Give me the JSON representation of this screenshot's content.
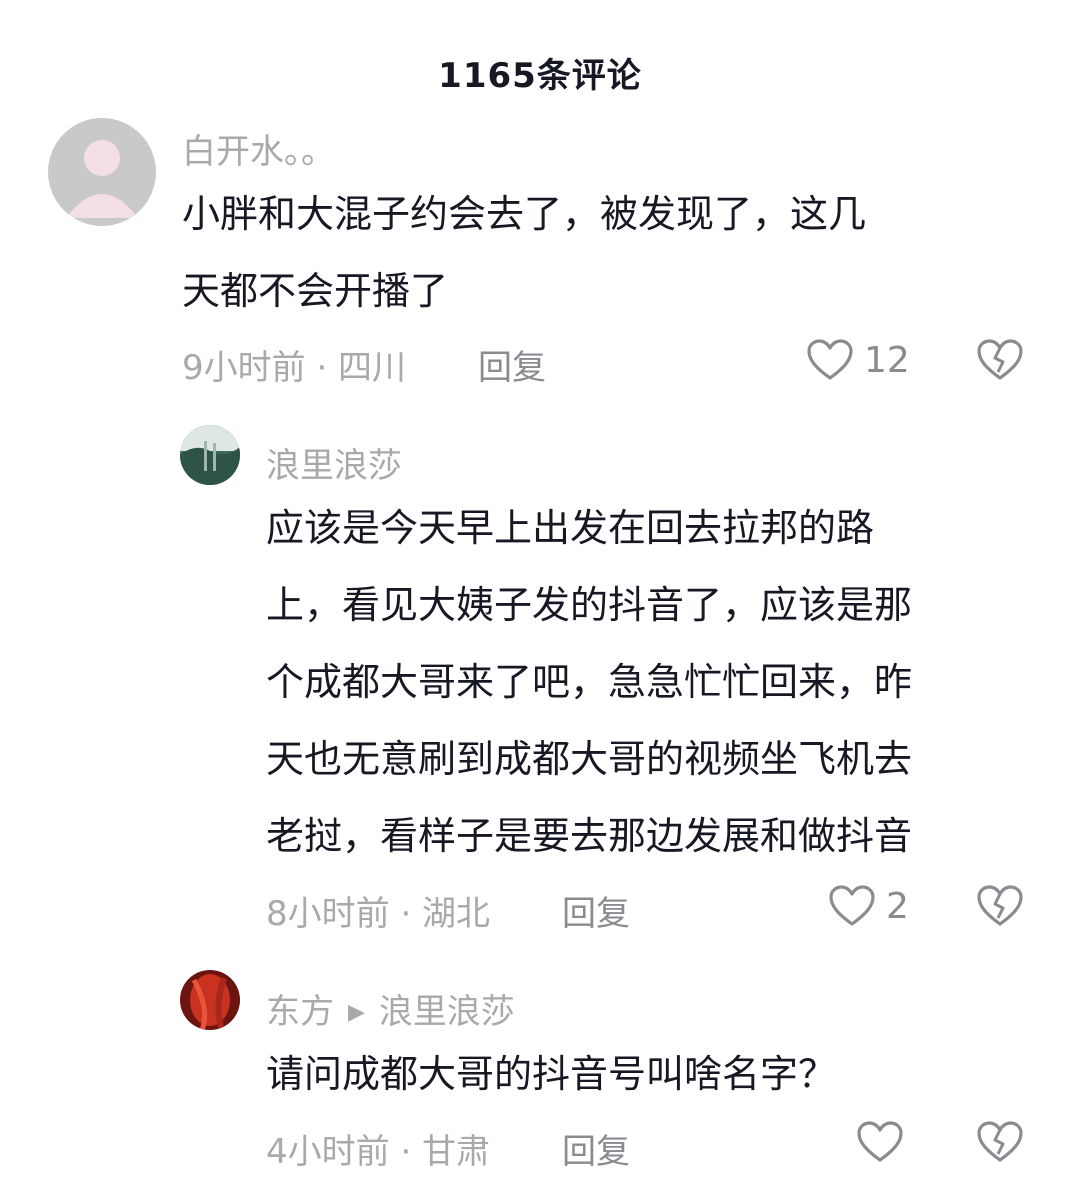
{
  "header": {
    "title": "1165条评论"
  },
  "comments": [
    {
      "author": "白开水。。",
      "text": "小胖和大混子约会去了，被发现了，这几\n天都不会开播了",
      "time_location": "9小时前 · 四川",
      "reply_label": "回复",
      "likes": "12",
      "avatar_icon": "default-user-icon"
    },
    {
      "author": "浪里浪莎",
      "text": "应该是今天早上出发在回去拉邦的路\n上，看见大姨子发的抖音了，应该是那\n个成都大哥来了吧，急急忙忙回来，昨\n天也无意刷到成都大哥的视频坐飞机去\n老挝，看样子是要去那边发展和做抖音",
      "time_location": "8小时前 · 湖北",
      "reply_label": "回复",
      "likes": "2",
      "avatar_icon": "landscape-photo-icon"
    },
    {
      "author": "东方",
      "reply_to": "浪里浪莎",
      "text": "请问成都大哥的抖音号叫啥名字？",
      "time_location": "4小时前 · 甘肃",
      "reply_label": "回复",
      "likes": "",
      "avatar_icon": "red-photo-icon"
    }
  ],
  "colors": {
    "text_primary": "#161823",
    "text_secondary": "#a8a9ad",
    "icon_gray": "#8a8b91"
  }
}
